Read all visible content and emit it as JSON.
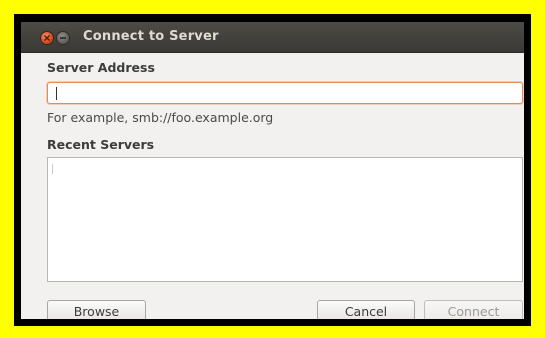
{
  "window": {
    "title": "Connect to Server"
  },
  "server_address": {
    "label": "Server Address",
    "value": "",
    "hint": "For example, smb://foo.example.org"
  },
  "recent_servers": {
    "label": "Recent Servers",
    "items": []
  },
  "buttons": {
    "browse": "Browse",
    "cancel": "Cancel",
    "connect": "Connect"
  },
  "colors": {
    "highlight_background": "#ffff00",
    "titlebar": "#3c3b37",
    "close_button": "#dd4814",
    "input_focus_border": "#e68a5c"
  },
  "icons": [
    "close-icon",
    "minimize-icon"
  ]
}
